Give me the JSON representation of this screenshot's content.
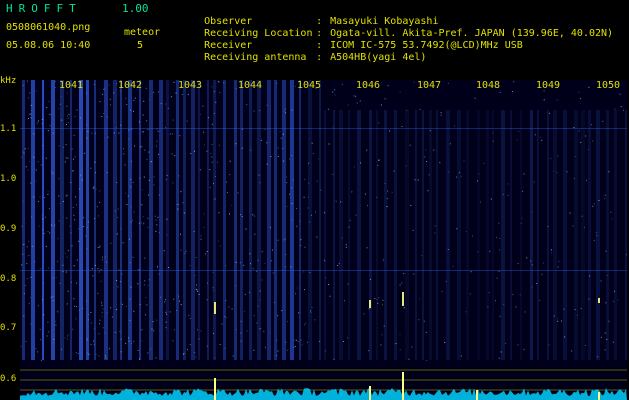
{
  "header": {
    "app_name": "HROFFT",
    "version": "1.00",
    "file_name": "0508061040.png",
    "datetime": "05.08.06 10:40",
    "meteor_label": "meteor",
    "meteor_count": "5"
  },
  "info": [
    {
      "key": "Observer",
      "value": "Masayuki Kobayashi"
    },
    {
      "key": "Receiving Location",
      "value": "Ogata-vill. Akita-Pref. JAPAN (139.96E, 40.02N)"
    },
    {
      "key": "Receiver",
      "value": "ICOM IC-575 53.7492(@LCD)MHz USB"
    },
    {
      "key": "Receiving antenna",
      "value": "A504HB(yagi 4el)"
    }
  ],
  "axis": {
    "unit": "kHz",
    "y_ticks": [
      "1.1",
      "1.0",
      "0.9",
      "0.8",
      "0.7",
      "0.6"
    ],
    "time_ticks": [
      "1041",
      "1042",
      "1043",
      "1044",
      "1045",
      "1046",
      "1047",
      "1048",
      "1049",
      "1050"
    ]
  },
  "colors": {
    "text": "#e0e000",
    "title": "#00e0a0",
    "signal": "#3a6cff",
    "trace": "#00d0ff",
    "meteor": "#ffff80"
  }
}
